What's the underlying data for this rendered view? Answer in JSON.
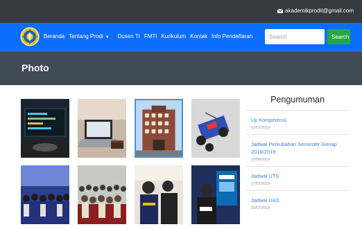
{
  "topbar": {
    "email": "akademikprodit@gmail.com",
    "mail_icon": "envelope-icon"
  },
  "nav": {
    "logo": "university-seal-logo",
    "items": [
      {
        "label": "Beranda"
      },
      {
        "label": "Tentang Prodi",
        "dropdown": true
      },
      {
        "label": "Dosen TI"
      },
      {
        "label": "FMTI"
      },
      {
        "label": "Kurikulum"
      },
      {
        "label": "Kontak"
      },
      {
        "label": "Info Pendaftaran"
      }
    ],
    "search_placeholder": "Search",
    "search_button": "Search",
    "colors": {
      "nav": "#0d6efd",
      "search_button": "#28a745",
      "topbar": "#343a40"
    }
  },
  "header": {
    "title": "Photo"
  },
  "gallery": {
    "photos": [
      {
        "name": "photo-monitor-code"
      },
      {
        "name": "photo-laptop-cake"
      },
      {
        "name": "photo-campus-building",
        "selected": true
      },
      {
        "name": "photo-robot-car"
      },
      {
        "name": "photo-group-stage"
      },
      {
        "name": "photo-seminar-audience"
      },
      {
        "name": "photo-students-event"
      },
      {
        "name": "photo-poster-presentation"
      }
    ]
  },
  "sidebar": {
    "title": "Pengumuman",
    "items": [
      {
        "title": "Uji Kompetensi",
        "date": "12/07/2019"
      },
      {
        "title": "Jadwal Perkuliahan Semester Genap 2018/2019",
        "date": "22/06/2019"
      },
      {
        "title": "Jadwal UTS",
        "date": "17/07/2019"
      },
      {
        "title": "Jadwal UAS",
        "date": "15/07/2019"
      }
    ]
  }
}
